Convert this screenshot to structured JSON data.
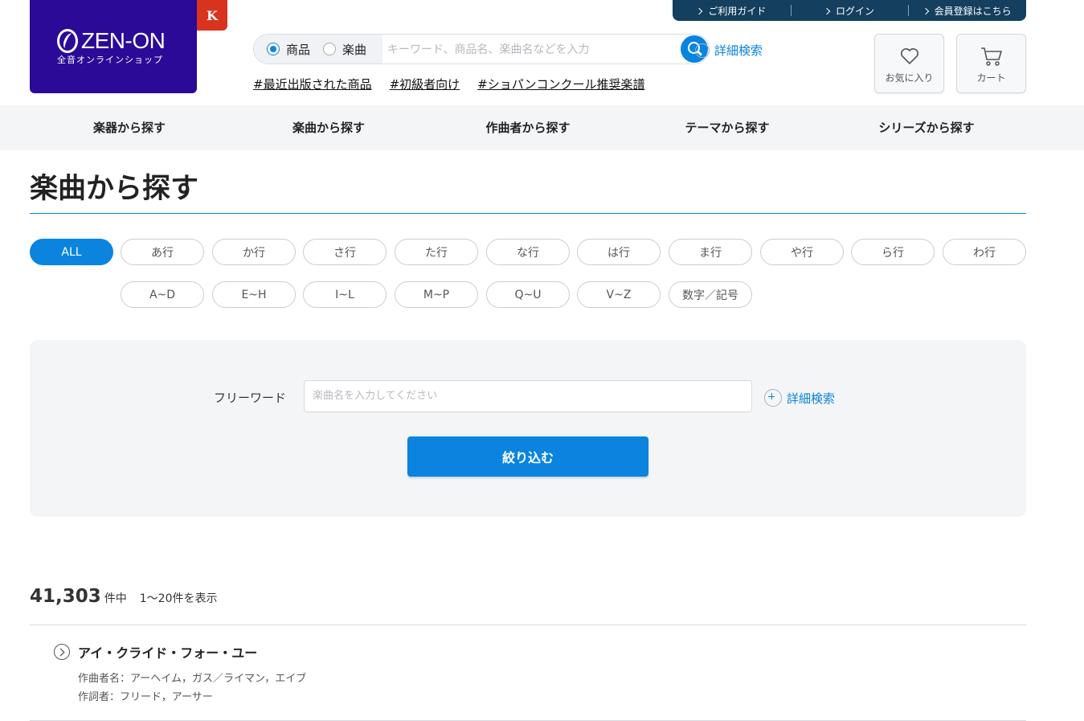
{
  "header": {
    "logo_text": "ZEN-ON",
    "logo_sub": "全音オンラインショップ",
    "k_badge": "K",
    "top_links": [
      "ご利用ガイド",
      "ログイン",
      "会員登録はこちら"
    ],
    "search": {
      "radio_product": "商品",
      "radio_song": "楽曲",
      "selected": "商品",
      "placeholder": "キーワード、商品名、楽曲名などを入力"
    },
    "advanced_search": "詳細検索",
    "tags": [
      "#最近出版された商品",
      "#初級者向け",
      "#ショパンコンクール推奨楽譜"
    ],
    "favorites_label": "お気に入り",
    "cart_label": "カート"
  },
  "nav": [
    "楽器から探す",
    "楽曲から探す",
    "作曲者から探す",
    "テーマから探す",
    "シリーズから探す"
  ],
  "page_title": "楽曲から探す",
  "kana_filters": [
    "ALL",
    "あ行",
    "か行",
    "さ行",
    "た行",
    "な行",
    "は行",
    "ま行",
    "や行",
    "ら行",
    "わ行"
  ],
  "alpha_filters": [
    "A~D",
    "E~H",
    "I~L",
    "M~P",
    "Q~U",
    "V~Z",
    "数字／記号"
  ],
  "active_filter": "ALL",
  "filter_box": {
    "label": "フリーワード",
    "placeholder": "楽曲名を入力してください",
    "advanced": "詳細検索",
    "submit": "絞り込む"
  },
  "results": {
    "total": "41,303",
    "unit": "件中",
    "range": "1〜20件を表示",
    "items": [
      {
        "title": "アイ・クライド・フォー・ユー",
        "composer": "作曲者名：アーヘイム，ガス／ライマン，エイブ",
        "lyricist": "作詞者：フリード，アーサー"
      }
    ]
  },
  "colors": {
    "brand_purple": "#2a0a96",
    "accent_blue": "#0a84de",
    "badge_red": "#d8331e",
    "toplinks_navy": "#143f5e"
  }
}
